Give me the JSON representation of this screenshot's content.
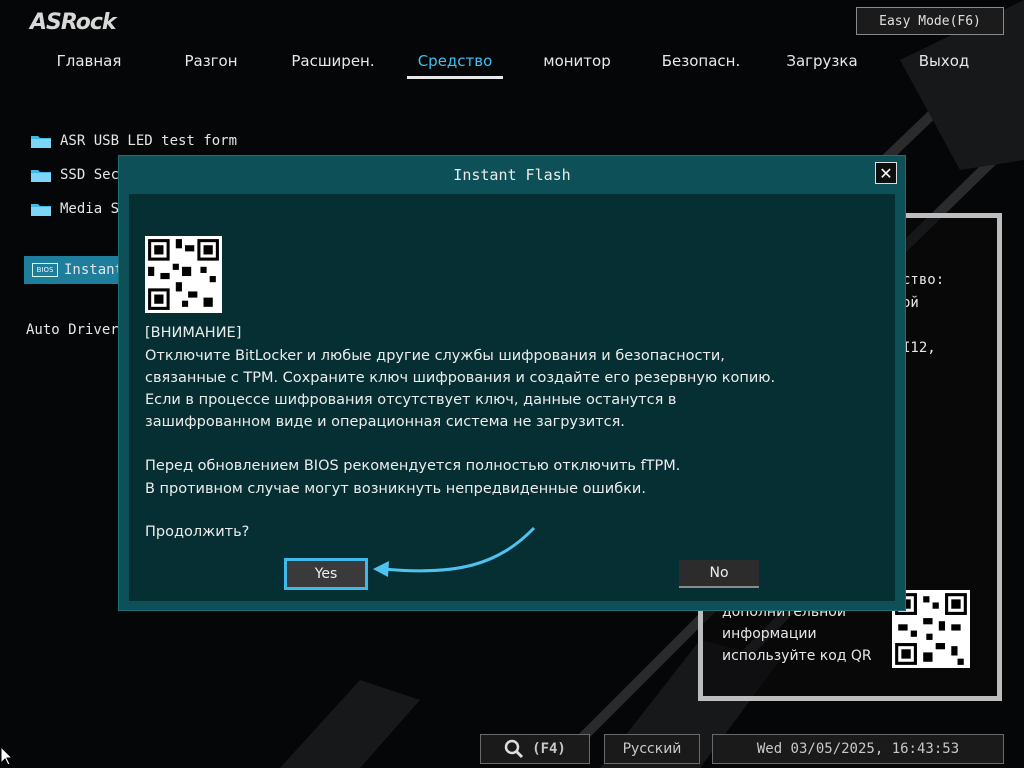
{
  "header": {
    "brand": "ASRock",
    "easy_mode_label": "Easy Mode(F6)"
  },
  "nav": {
    "tabs": [
      {
        "label": "Главная",
        "active": false
      },
      {
        "label": "Разгон",
        "active": false
      },
      {
        "label": "Расширен.",
        "active": false
      },
      {
        "label": "Средство",
        "active": true
      },
      {
        "label": "монитор",
        "active": false
      },
      {
        "label": "Безопасн.",
        "active": false
      },
      {
        "label": "Загрузка",
        "active": false
      },
      {
        "label": "Выход",
        "active": false
      }
    ]
  },
  "tool_menu": {
    "items": [
      {
        "label": "ASR USB LED test form",
        "icon": "folder-icon"
      },
      {
        "label": "SSD Secure Erase Tool",
        "icon": "folder-icon"
      },
      {
        "label": "Media S",
        "icon": "folder-icon"
      },
      {
        "label": "Instant",
        "icon": "bios-chip-icon",
        "selected": true
      }
    ],
    "auto_driver_label": "Auto Driver"
  },
  "info_panel": {
    "lines": [
      "ство:",
      "ой",
      "I12,"
    ],
    "qr_text": "дополнительной информации используйте код QR"
  },
  "dialog": {
    "title": "Instant Flash",
    "warning_heading": "[ВНИМАНИЕ]",
    "paragraph1": [
      "Отключите BitLocker и любые другие службы шифрования и безопасности,",
      "связанные с TPM. Сохраните ключ шифрования и создайте его резервную копию.",
      "Если в процессе шифрования отсутствует ключ, данные останутся в",
      "зашифрованном виде и операционная система не загрузится."
    ],
    "paragraph2": [
      "Перед обновлением BIOS рекомендуется полностью отключить fTPM.",
      "В противном случае могут возникнуть непредвиденные ошибки."
    ],
    "question": "Продолжить?",
    "yes_label": "Yes",
    "no_label": "No"
  },
  "status_bar": {
    "search_shortcut": "(F4)",
    "language": "Русский",
    "datetime": "Wed 03/05/2025, 16:43:53"
  },
  "colors": {
    "accent": "#3fc0f0",
    "dialog_frame": "#0d5058",
    "dialog_body": "#062f34",
    "yes_highlight": "#3fb9ea",
    "selected_row": "#1f7e9c"
  }
}
